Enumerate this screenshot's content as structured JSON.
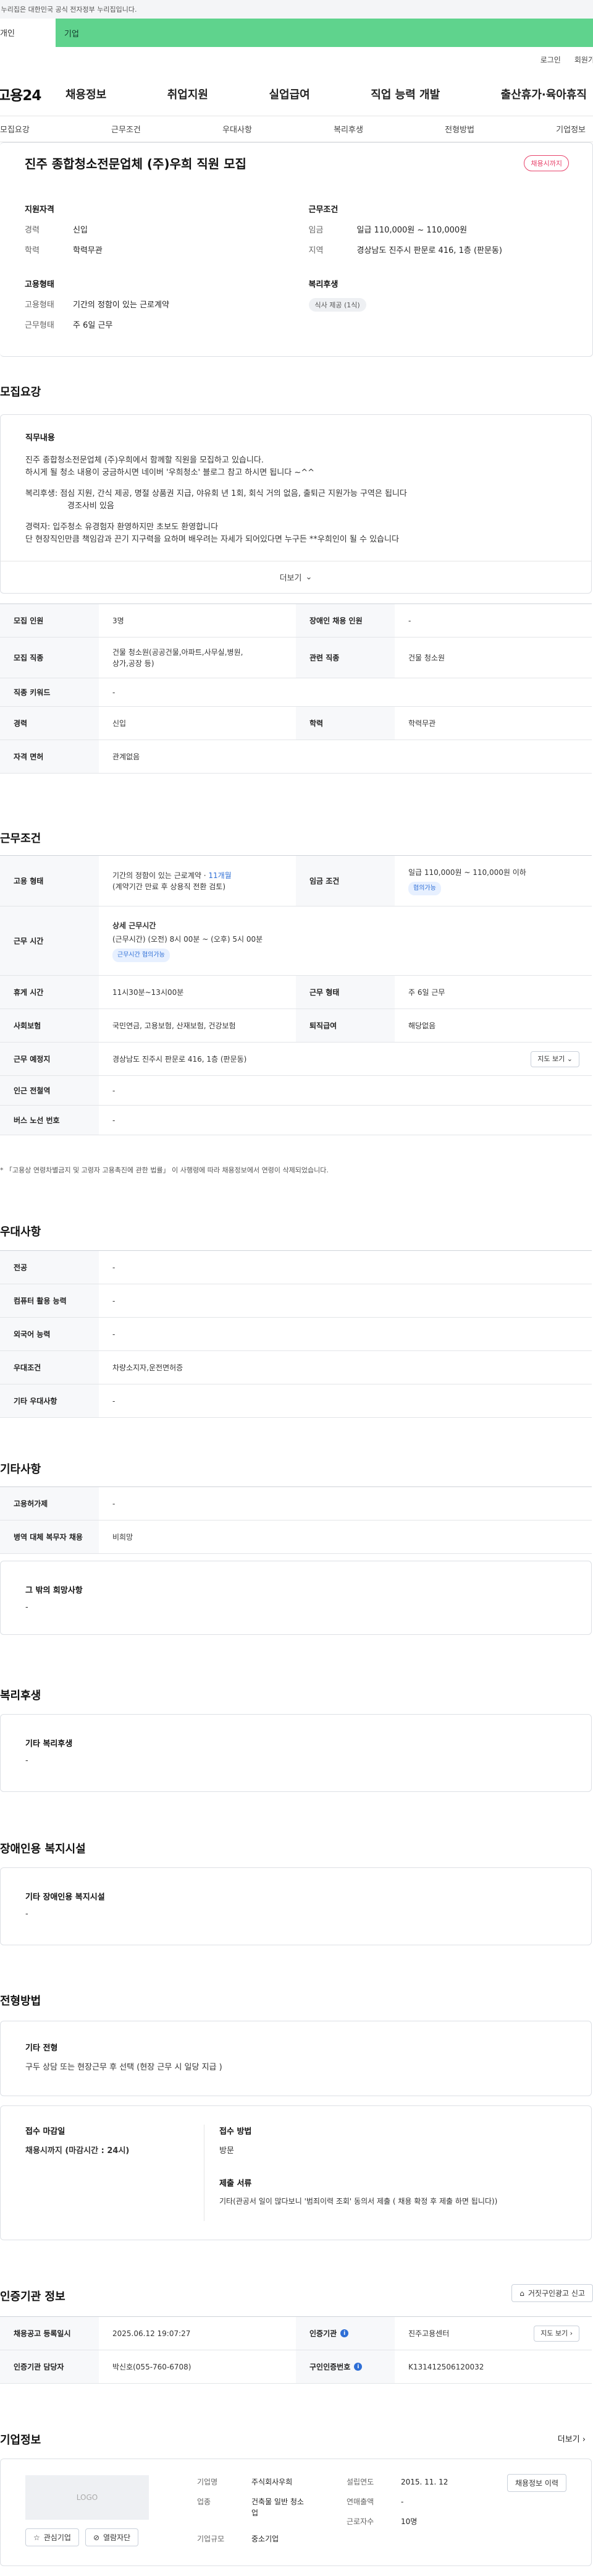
{
  "gov_banner": "이 누리집은 대한민국 공식 전자정부 누리집입니다.",
  "user_tabs": {
    "personal": "개인",
    "company": "기업"
  },
  "util_links": {
    "login": "로그인",
    "join": "회원가입"
  },
  "logo": "고용24",
  "main_nav": [
    "채용정보",
    "취업지원",
    "실업급여",
    "직업 능력 개발",
    "출산휴가·육아휴직"
  ],
  "sub_tabs": [
    "모집요강",
    "근무조건",
    "우대사항",
    "복리후생",
    "전형방법",
    "기업정보"
  ],
  "job": {
    "title": "진주 종합청소전문업체 (주)우희 직원 모집",
    "status": "채용시까지",
    "qualification_title": "지원자격",
    "career_label": "경력",
    "career_value": "신입",
    "education_label": "학력",
    "education_value": "학력무관",
    "work_cond_title": "근무조건",
    "wage_label": "임금",
    "wage_value": "일급 110,000원 ~ 110,000원",
    "region_label": "지역",
    "region_value": "경상남도 진주시 판문로 416, 1층 (판문동)",
    "employment_title": "고용형태",
    "emp_type_label": "고용형태",
    "emp_type_value": "기간의 정함이 있는 근로계약",
    "work_type_label": "근무형태",
    "work_type_value": "주 6일 근무",
    "welfare_title": "복리후생",
    "welfare_tag": "식사 제공 (1식)"
  },
  "recruit": {
    "section_title": "모집요강",
    "content_title": "직무내용",
    "lines": [
      "진주 종합청소전문업체 (주)우희에서 함께할 직원을 모집하고 있습니다.",
      "하시게 될 청소 내용이 궁금하시면 네이버 '우희청소' 블로그 참고 하시면 됩니다 ~^^",
      "",
      "복리후생: 점심 지원, 간식 제공, 명절 상품권 지급, 야유회 년 1회, 회식 거의 없음, 출퇴근 지원가능 구역은 됩니다",
      "          경조사비 있음",
      "",
      "경력자: 입주청소 유경험자 환영하지만 초보도 환영합니다",
      "단 현장직인만큼 책임감과 끈기 지구력을 요하며 배우려는 자세가 되어있다면 누구든 **우희인이 될 수 있습니다"
    ],
    "more": "더보기",
    "rows": {
      "headcount_label": "모집 인원",
      "headcount_value": "3명",
      "disabled_label": "장애인 채용 인원",
      "disabled_value": "-",
      "job_label": "모집 직종",
      "job_value_1": "건물 청소원(공공건물,아파트,사무실,병원,",
      "job_value_2": "상가,공장 등)",
      "related_label": "관련 직종",
      "related_value": "건물 청소원",
      "keyword_label": "직종 키워드",
      "keyword_value": "-",
      "career_label": "경력",
      "career_value": "신입",
      "edu_label": "학력",
      "edu_value": "학력무관",
      "cert_label": "자격 면허",
      "cert_value": "관계없음"
    }
  },
  "conditions": {
    "section_title": "근무조건",
    "emp_label": "고용 형태",
    "emp_value_1": "기간의 정함이 있는 근로계약 · ",
    "emp_value_months": "11개월",
    "emp_value_2": "(계약기간 만료 후 상용직 전환 검토)",
    "wage_label": "임금 조건",
    "wage_value": "일급 110,000원 ~ 110,000원 이하",
    "wage_badge": "협의가능",
    "hours_label": "근무 시간",
    "hours_title": "상세 근무시간",
    "hours_value": "(근무시간) (오전) 8시 00분 ~ (오후) 5시 00분",
    "hours_badge": "근무시간 협의가능",
    "break_label": "휴게 시간",
    "break_value": "11시30분~13시00분",
    "work_type_label": "근무 형태",
    "work_type_value": "주 6일 근무",
    "insurance_label": "사회보험",
    "insurance_value": "국민연금, 고용보험, 산재보험, 건강보험",
    "severance_label": "퇴직급여",
    "severance_value": "해당없음",
    "location_label": "근무 예정지",
    "location_value": "경상남도 진주시 판문로 416, 1층 (판문동)",
    "map_btn": "지도 보기",
    "subway_label": "인근 전철역",
    "subway_value": "-",
    "bus_label": "버스 노선 번호",
    "bus_value": "-",
    "note": "* 「고용상 연령차별금지 및 고령자 고용촉진에 관한 법률」 이 사행령에 따라 채용정보에서 연령이 삭제되었습니다."
  },
  "preference": {
    "section_title": "우대사항",
    "major_label": "전공",
    "major_value": "-",
    "computer_label": "컴퓨터 활용 능력",
    "computer_value": "-",
    "lang_label": "외국어 능력",
    "lang_value": "-",
    "cond_label": "우대조건",
    "cond_value": "차량소지자,운전면허증",
    "other_label": "기타 우대사항",
    "other_value": "-"
  },
  "etc": {
    "section_title": "기타사항",
    "contract_label": "고용허가제",
    "contract_value": "-",
    "military_label": "병역 대체 복무자 채용",
    "military_value": "비희망",
    "wish_title": "그 밖의 희망사항",
    "wish_value": "-"
  },
  "welfare": {
    "section_title": "복리후생",
    "box_title": "기타 복리후생",
    "box_value": "-"
  },
  "disabled_facility": {
    "section_title": "장애인용 복지시설",
    "box_title": "기타 장애인용 복지시설",
    "box_value": "-"
  },
  "process": {
    "section_title": "전형방법",
    "box_title": "기타 전형",
    "box_value": "구두 상담 또는 현장근무 후 선택 (현장 근무 시 일당 지급 )",
    "deadline_title": "접수 마감일",
    "deadline_value": "채용시까지 (마감시간 : 24시)",
    "method_title": "접수 방법",
    "method_value": "방문",
    "docs_title": "제출 서류",
    "docs_value": "기타(관공서 일이 많다보니 '범죄이력 조회' 동의서 제출 ( 채용 확정 후 제출 하면 됩니다))"
  },
  "cert": {
    "section_title": "인증기관 정보",
    "report_btn": "거짓구인광고 신고",
    "reg_label": "채용공고 등록일시",
    "reg_value": "2025.06.12 19:07:27",
    "org_label": "인증기관",
    "org_value": "진주고용센터",
    "map_btn": "지도 보기",
    "manager_label": "인증기관 담당자",
    "manager_value": "박신호(055-760-6708)",
    "id_label": "구인인증번호",
    "id_value": "K131412506120032"
  },
  "company": {
    "section_title": "기업정보",
    "more": "더보기",
    "logo_placeholder": "LOGO",
    "fav_btn": "관심기업",
    "follow_btn": "열람자단",
    "name_label": "기업명",
    "name_value": "주식회사우희",
    "industry_label": "업종",
    "industry_value_1": "건축물 일반 청소",
    "industry_value_2": "업",
    "scale_label": "기업규모",
    "scale_value": "중소기업",
    "founded_label": "설립연도",
    "founded_value": "2015. 11. 12",
    "sales_label": "연매출액",
    "sales_value": "-",
    "employees_label": "근로자수",
    "employees_value": "10명",
    "jobs_btn": "채용정보 이력"
  },
  "colors": {
    "accent_green": "#5fd38d",
    "status_pink": "#e8436b",
    "link_blue": "#2f6fd6",
    "deadline_red": "#e23c4f"
  }
}
